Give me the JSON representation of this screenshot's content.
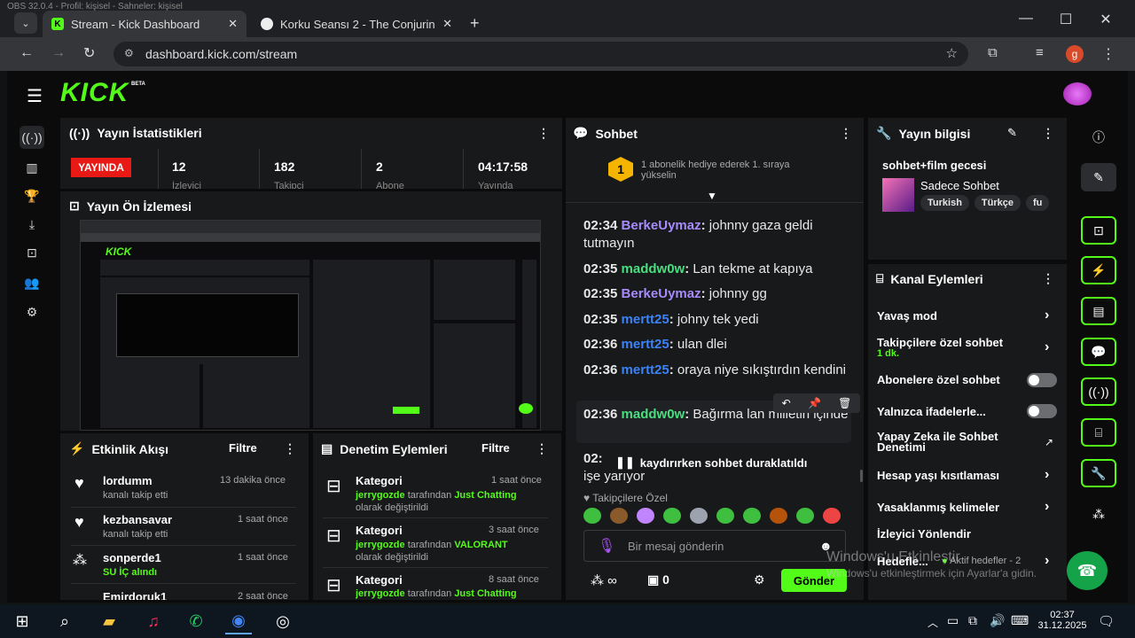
{
  "obs_title": "OBS 32.0.4 - Profil: kişisel - Sahneler: kişisel",
  "browser": {
    "tabs": [
      {
        "label": "Stream - Kick Dashboard"
      },
      {
        "label": "Korku Seansı 2 - The Conjuring"
      }
    ],
    "url": "dashboard.kick.com/stream",
    "profile_initial": "g"
  },
  "header": {
    "logo": "KICK",
    "beta": "BETA"
  },
  "stats": {
    "title": "Yayın İstatistikleri",
    "live_badge": "YAYINDA",
    "items": [
      {
        "value": "12",
        "label": "İzleyici"
      },
      {
        "value": "182",
        "label": "Takipçi"
      },
      {
        "value": "2",
        "label": "Abone"
      },
      {
        "value": "04:17:58",
        "label": "Yayında"
      }
    ]
  },
  "preview": {
    "title": "Yayın Ön İzlemesi"
  },
  "activity": {
    "title": "Etkinlik Akışı",
    "filter": "Filtre",
    "items": [
      {
        "user": "lordumm",
        "desc": "kanalı takip etti",
        "time": "13 dakika önce"
      },
      {
        "user": "kezbansavar",
        "desc": "kanalı takip etti",
        "time": "1 saat önce"
      },
      {
        "user": "sonperde1",
        "desc": "SU İÇ alındı",
        "time": "1 saat önce"
      },
      {
        "user": "Emirdoruk1",
        "desc": "",
        "time": "2 saat önce"
      }
    ]
  },
  "moderation": {
    "title": "Denetim Eylemleri",
    "filter": "Filtre",
    "items": [
      {
        "title": "Kategori",
        "time": "1 saat önce",
        "user": "jerrygozde",
        "mid": "tarafından",
        "cat": "Just Chatting",
        "tail": "olarak değiştirildi"
      },
      {
        "title": "Kategori",
        "time": "3 saat önce",
        "user": "jerrygozde",
        "mid": "tarafından",
        "cat": "VALORANT",
        "tail": "olarak değiştirildi"
      },
      {
        "title": "Kategori",
        "time": "8 saat önce",
        "user": "jerrygozde",
        "mid": "tarafından",
        "cat": "Just Chatting",
        "tail": ""
      }
    ]
  },
  "chat": {
    "title": "Sohbet",
    "gift_badge": "1",
    "gift_text": "1 abonelik hediye ederek 1. sıraya yükselin",
    "messages": [
      {
        "time": "02:34",
        "user": "BerkeUymaz",
        "color": "#a78bfa",
        "text": "johnny gaza geldi tutmayın"
      },
      {
        "time": "02:35",
        "user": "maddw0w",
        "color": "#4ade80",
        "text": "Lan tekme at kapıya"
      },
      {
        "time": "02:35",
        "user": "BerkeUymaz",
        "color": "#a78bfa",
        "text": "johnny gg"
      },
      {
        "time": "02:35",
        "user": "mertt25",
        "color": "#3b82f6",
        "text": "johny tek yedi"
      },
      {
        "time": "02:36",
        "user": "mertt25",
        "color": "#3b82f6",
        "text": "ulan dlei"
      },
      {
        "time": "02:36",
        "user": "mertt25",
        "color": "#3b82f6",
        "text": "oraya niye sıkıştırdın kendini"
      },
      {
        "time": "02:36",
        "user": "maddw0w",
        "color": "#4ade80",
        "text": "Bağırma lan milletin içinde"
      }
    ],
    "partial_time": "02:",
    "partial_text": "işe yarıyor",
    "paused_text": "kaydırırken sohbet duraklatıldı",
    "followers_only": "Takipçilere Özel",
    "input_placeholder": "Bir mesaj gönderin",
    "points": "0",
    "send": "Gönder"
  },
  "stream_info": {
    "title": "Yayın bilgisi",
    "stream_title": "sohbet+film gecesi",
    "category": "Sadece Sohbet",
    "tags": [
      "Turkish",
      "Türkçe",
      "fu"
    ]
  },
  "channel_actions": {
    "title": "Kanal Eylemleri",
    "items": [
      {
        "label": "Yavaş mod",
        "sub": "",
        "control": "chevron"
      },
      {
        "label": "Takipçilere özel sohbet",
        "sub": "1 dk.",
        "control": "chevron"
      },
      {
        "label": "Abonelere özel sohbet",
        "sub": "",
        "control": "toggle"
      },
      {
        "label": "Yalnızca ifadelerle...",
        "sub": "",
        "control": "toggle"
      },
      {
        "label": "Yapay Zeka ile Sohbet Denetimi",
        "sub": "",
        "control": "external"
      },
      {
        "label": "Hesap yaşı kısıtlaması",
        "sub": "",
        "control": "chevron"
      },
      {
        "label": "Yasaklanmış kelimeler",
        "sub": "",
        "control": "chevron"
      },
      {
        "label": "İzleyici Yönlendir",
        "sub": "",
        "control": "none"
      },
      {
        "label": "Hedefle...",
        "sub": "Aktif hedefler - 2",
        "control": "chevron"
      }
    ]
  },
  "watermark": {
    "line1": "Windows'u Etkinleştir",
    "line2": "Windows'u etkinleştirmek için Ayarlar'a gidin."
  },
  "taskbar": {
    "time": "02:37",
    "date": "31.12.2025"
  },
  "colors": {
    "accent": "#53fc18",
    "live": "#e91916"
  }
}
